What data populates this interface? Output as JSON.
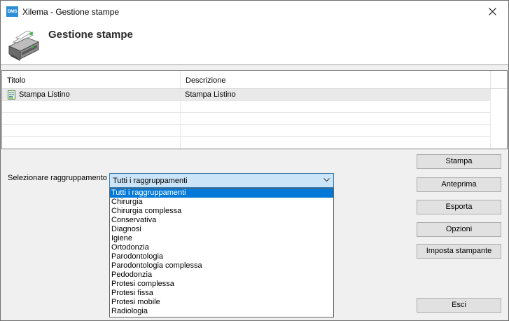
{
  "window": {
    "icon_text": "DMS",
    "title": "Xilema - Gestione stampe"
  },
  "header": {
    "title": "Gestione stampe"
  },
  "grid": {
    "columns": [
      "Titolo",
      "Descrizione"
    ],
    "rows": [
      {
        "titolo": "Stampa Listino",
        "descrizione": "Stampa Listino"
      }
    ]
  },
  "grouping": {
    "label": "Selezionare raggruppamento",
    "selected": "Tutti i raggruppamenti",
    "options": [
      "Tutti i raggruppamenti",
      "Chirurgia",
      "Chirurgia complessa",
      "Conservativa",
      "Diagnosi",
      "Igiene",
      "Ortodonzia",
      "Parodontologia",
      "Parodontologia complessa",
      "Pedodonzia",
      "Protesi complessa",
      "Protesi fissa",
      "Protesi mobile",
      "Radiologia"
    ]
  },
  "buttons": {
    "stampa": "Stampa",
    "anteprima": "Anteprima",
    "esporta": "Esporta",
    "opzioni": "Opzioni",
    "imposta_stampante": "Imposta stampante",
    "esci": "Esci"
  },
  "icons": {
    "app": "dms-app-icon",
    "close": "close-icon",
    "printer": "printer-icon",
    "document": "document-icon",
    "dropdown": "chevron-down-icon"
  },
  "colors": {
    "selection": "#0078d7",
    "combo_focus": "#cce4f7",
    "app_icon": "#2b8ed6"
  }
}
